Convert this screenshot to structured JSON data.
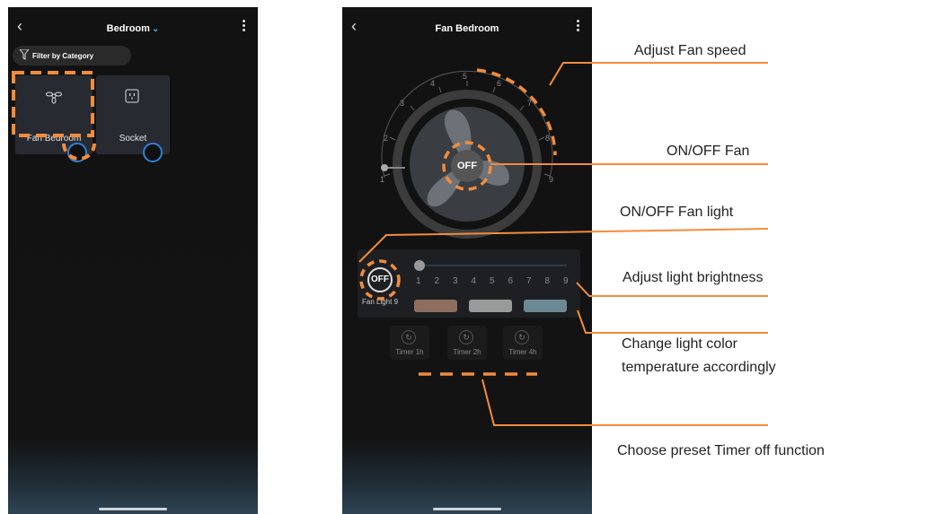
{
  "screen1": {
    "title": "Bedroom",
    "filter_label": "Filter by Category",
    "devices": [
      {
        "label": "Fan Bedroom",
        "icon": "fan-icon"
      },
      {
        "label": "Socket",
        "icon": "socket-icon"
      }
    ]
  },
  "screen2": {
    "title": "Fan Bedroom",
    "fan_toggle": "OFF",
    "speed_ticks": [
      "1",
      "2",
      "3",
      "4",
      "5",
      "6",
      "7",
      "8",
      "9"
    ],
    "light_toggle": "OFF",
    "light_label": "Fan Light 9",
    "brightness_ticks": [
      "1",
      "2",
      "3",
      "4",
      "5",
      "6",
      "7",
      "8",
      "9"
    ],
    "color_swatches": [
      "#8d6e5f",
      "#9a9a9a",
      "#6c8a94"
    ],
    "timers": [
      "Timer 1h",
      "Timer 2h",
      "Timer 4h"
    ]
  },
  "annotations": {
    "fan_speed": "Adjust Fan speed",
    "onoff_fan": "ON/OFF Fan",
    "onoff_light": "ON/OFF Fan light",
    "brightness": "Adjust light brightness",
    "color_temp_1": "Change light color",
    "color_temp_2": "temperature accordingly",
    "timer": "Choose preset Timer off function"
  },
  "colors": {
    "accent_orange": "#f28c3c",
    "ring_blue": "#2f7fd8",
    "background_dark": "#131313"
  }
}
